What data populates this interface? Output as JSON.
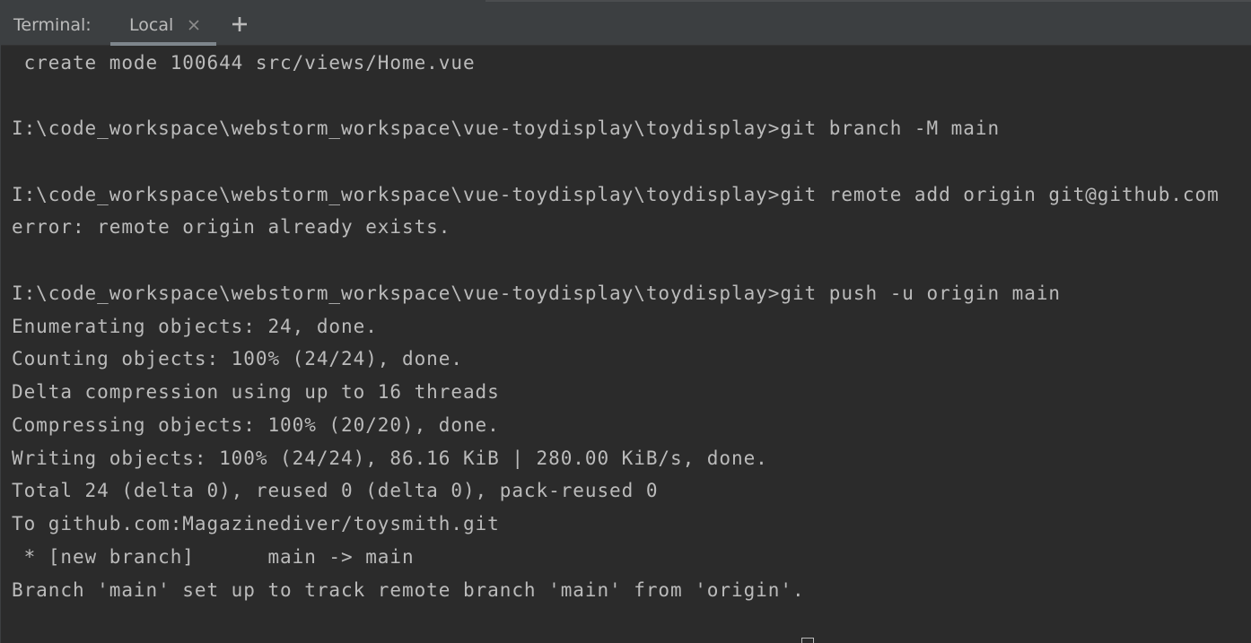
{
  "tabbar": {
    "panel_title": "Terminal:",
    "tabs": [
      {
        "label": "Local",
        "close_icon": "close-icon"
      }
    ],
    "add_icon": "plus-icon"
  },
  "terminal": {
    "lines": [
      " create mode 100644 src/views/Home.vue",
      "",
      "I:\\code_workspace\\webstorm_workspace\\vue-toydisplay\\toydisplay>git branch -M main",
      "",
      "I:\\code_workspace\\webstorm_workspace\\vue-toydisplay\\toydisplay>git remote add origin git@github.com",
      "error: remote origin already exists.",
      "",
      "I:\\code_workspace\\webstorm_workspace\\vue-toydisplay\\toydisplay>git push -u origin main",
      "Enumerating objects: 24, done.",
      "Counting objects: 100% (24/24), done.",
      "Delta compression using up to 16 threads",
      "Compressing objects: 100% (20/20), done.",
      "Writing objects: 100% (24/24), 86.16 KiB | 280.00 KiB/s, done.",
      "Total 24 (delta 0), reused 0 (delta 0), pack-reused 0",
      "To github.com:Magazinediver/toysmith.git",
      " * [new branch]      main -> main",
      "Branch 'main' set up to track remote branch 'main' from 'origin'."
    ]
  },
  "colors": {
    "background": "#2b2b2b",
    "tabbar": "#3c3f41",
    "text": "#bbbbbb",
    "active_tab_underline": "#7e868c"
  }
}
